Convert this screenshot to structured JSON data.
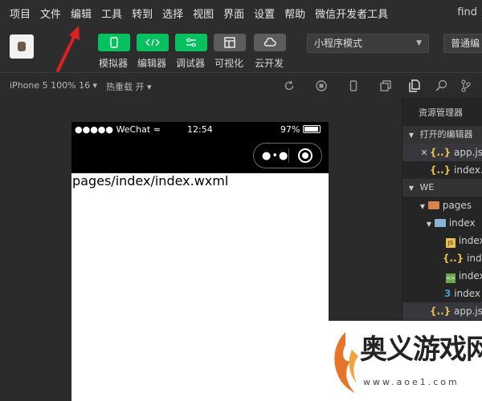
{
  "menubar": {
    "items": [
      "项目",
      "文件",
      "编辑",
      "工具",
      "转到",
      "选择",
      "视图",
      "界面",
      "设置",
      "帮助",
      "微信开发者工具"
    ],
    "find": "find"
  },
  "toolbar": {
    "buttons": [
      {
        "label": "模拟器",
        "icon": "phone-icon",
        "color": "#07c160"
      },
      {
        "label": "编辑器",
        "icon": "code-icon",
        "color": "#07c160"
      },
      {
        "label": "调试器",
        "icon": "debug-icon",
        "color": "#07c160"
      },
      {
        "label": "可视化",
        "icon": "layout-icon",
        "color": "#5c5c5c"
      },
      {
        "label": "云开发",
        "icon": "cloud-icon",
        "color": "#5c5c5c"
      }
    ],
    "mode_select": "小程序模式",
    "compile_select": "普通编"
  },
  "simbar": {
    "device": "iPhone 5 100% 16 ▾",
    "hot_reload": "热重载 开 ▾"
  },
  "phone": {
    "signal": "●●●●● WeChat",
    "time": "12:54",
    "battery": "97%",
    "content": "pages/index/index.wxml"
  },
  "explorer": {
    "title": "资源管理器",
    "open_editors_header": "打开的编辑器",
    "open_editors": [
      "app.json",
      "index.js"
    ],
    "workspace_header": "WE",
    "tree": [
      {
        "label": "pages",
        "kind": "folder"
      },
      {
        "label": "index",
        "kind": "folder-open"
      },
      {
        "label": "index",
        "kind": "js"
      },
      {
        "label": "index",
        "kind": "json"
      },
      {
        "label": "index",
        "kind": "wxml"
      },
      {
        "label": "index",
        "kind": "css"
      },
      {
        "label": "app.json",
        "kind": "json"
      }
    ]
  },
  "watermark": {
    "brand": "奥义游戏网",
    "url": "www.aoe1.com"
  },
  "colors": {
    "accent_green": "#07c160",
    "annotation_red": "#e02020"
  }
}
